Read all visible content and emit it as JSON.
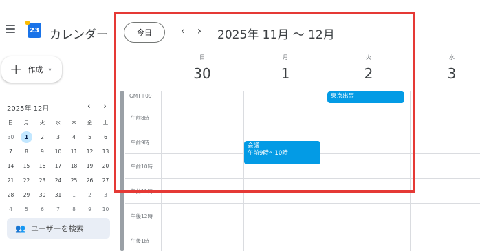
{
  "app": {
    "title": "カレンダー",
    "logo_text": "23"
  },
  "toolbar": {
    "today_label": "今日",
    "prev_icon": "‹",
    "next_icon": "›",
    "range_title": "2025年 11月 ～ 12月"
  },
  "create": {
    "plus": "+",
    "label": "作成",
    "caret": "▾"
  },
  "mini_calendar": {
    "title": "2025年 12月",
    "prev": "‹",
    "next": "›",
    "weekdays": [
      "日",
      "月",
      "火",
      "水",
      "木",
      "金",
      "土"
    ],
    "days": [
      "30",
      "1",
      "2",
      "3",
      "4",
      "5",
      "6",
      "7",
      "8",
      "9",
      "10",
      "11",
      "12",
      "13",
      "14",
      "15",
      "16",
      "17",
      "18",
      "19",
      "20",
      "21",
      "22",
      "23",
      "24",
      "25",
      "26",
      "27",
      "28",
      "29",
      "30",
      "31",
      "1",
      "2",
      "3",
      "4",
      "5",
      "6",
      "7",
      "8",
      "9",
      "10"
    ],
    "selected_index": 1
  },
  "user_search": {
    "label": "ユーザーを検索",
    "icon": "people-icon"
  },
  "days": [
    {
      "weekday": "日",
      "date": "30"
    },
    {
      "weekday": "月",
      "date": "1"
    },
    {
      "weekday": "火",
      "date": "2"
    },
    {
      "weekday": "水",
      "date": "3"
    }
  ],
  "timezone": "GMT+09",
  "hours": [
    "午前8時",
    "午前9時",
    "午前10時",
    "午前11時",
    "午後12時",
    "午後1時"
  ],
  "events": [
    {
      "title": "東京出張",
      "time": ""
    },
    {
      "title": "会議",
      "time": "午前9時～10時"
    }
  ],
  "colors": {
    "event": "#039be5",
    "highlight": "#e53935",
    "selected_day": "#c2e7ff"
  }
}
